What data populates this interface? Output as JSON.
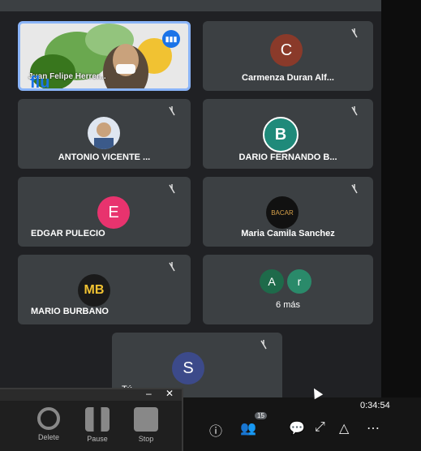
{
  "participants": [
    {
      "name": "Juan Felipe Herrer...",
      "type": "video",
      "speaking": true
    },
    {
      "name": "Carmenza Duran Alf...",
      "initial": "C",
      "color": "#8a3a2a",
      "muted": true
    },
    {
      "name": "ANTONIO VICENTE ...",
      "type": "photo",
      "muted": true
    },
    {
      "name": "DARIO FERNANDO B...",
      "initial": "B",
      "color": "#1f8a7a",
      "muted": true
    },
    {
      "name": "EDGAR PULECIO",
      "initial": "E",
      "color": "#e8336e",
      "muted": true
    },
    {
      "name": "Maria Camila Sanchez",
      "initial": "BACAR",
      "color": "#111111",
      "muted": true
    },
    {
      "name": "MARIO BURBANO",
      "initial": "MB",
      "color": "#1a1a1a",
      "muted": true
    },
    {
      "name": "6 más",
      "initials": [
        "A",
        "r"
      ],
      "color": "#1e6a4a"
    },
    {
      "name": "Tú",
      "initial": "S",
      "color": "#3c4a8a",
      "muted": true
    }
  ],
  "self_logo": "flu",
  "recorder": {
    "delete": "Delete",
    "pause": "Pause",
    "stop": "Stop"
  },
  "timer": "0:34:54",
  "participants_count": "15",
  "colors": {
    "tile": "#3c4043",
    "bg": "#202124",
    "accent": "#8ab4f8"
  }
}
